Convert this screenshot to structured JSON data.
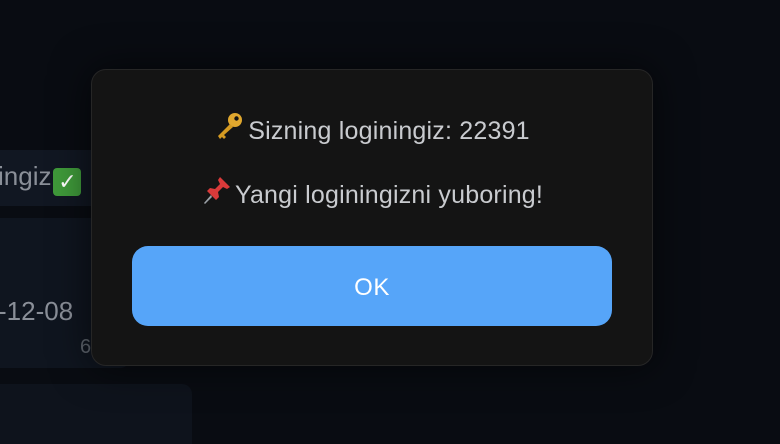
{
  "background_chat": {
    "fragment_1": "ingiz",
    "fragment_2": "-12-08",
    "fragment_3": "6"
  },
  "dialog": {
    "line1_text": "Sizning loginingiz: 22391",
    "line2_text": "Yangi loginingizni yuboring!",
    "ok_label": "OK"
  },
  "icons": {
    "line1_icon": "key-icon",
    "line2_icon": "pushpin-icon",
    "bg_icon": "check-mark-icon"
  },
  "colors": {
    "button": "#56a5f9",
    "dialog_bg": "#141414",
    "page_bg": "#090c12"
  }
}
